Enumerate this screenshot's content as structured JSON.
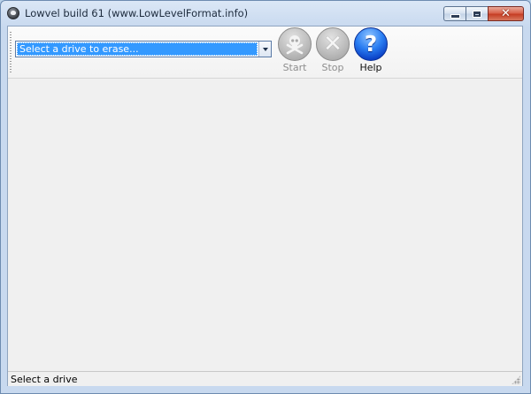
{
  "window": {
    "title": "Lowvel build 61 (www.LowLevelFormat.info)",
    "icon": "skull-icon"
  },
  "caption": {
    "minimize_icon": "minimize-icon",
    "maximize_icon": "maximize-icon",
    "close_icon": "close-icon",
    "close_glyph": "✕"
  },
  "toolbar": {
    "drive_select": {
      "value": "Select a drive to erase...",
      "options": [
        "Select a drive to erase..."
      ]
    },
    "start": {
      "label": "Start",
      "icon": "skull-crossbones-icon",
      "enabled": false
    },
    "stop": {
      "label": "Stop",
      "icon": "x-icon",
      "glyph": "✕",
      "enabled": false
    },
    "help": {
      "label": "Help",
      "icon": "question-icon",
      "glyph": "?",
      "enabled": true
    }
  },
  "statusbar": {
    "text": "Select a drive"
  },
  "colors": {
    "selection": "#3399ff",
    "help_blue": "#2a7ef2",
    "disabled_gray": "#8d8d8d"
  }
}
